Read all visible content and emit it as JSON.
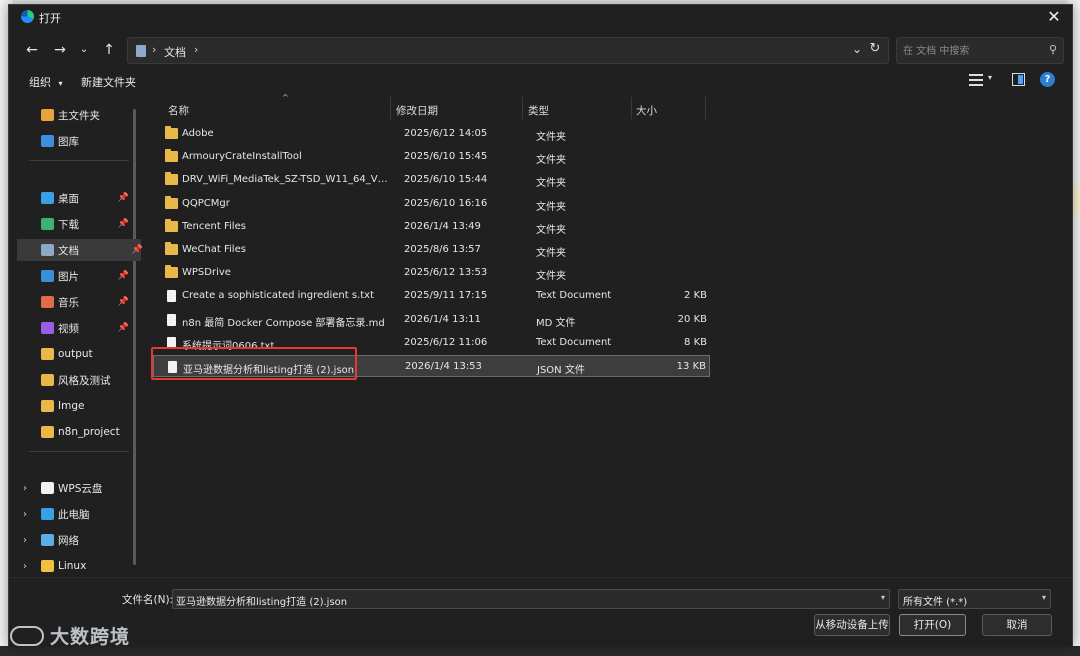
{
  "dialog": {
    "title": "打开"
  },
  "address": {
    "crumb": "文档",
    "separator": "›"
  },
  "search": {
    "placeholder": "在 文档 中搜索"
  },
  "toolbar": {
    "organize": "组织",
    "new_folder": "新建文件夹"
  },
  "nav": {
    "quick": [
      {
        "label": "主文件夹",
        "icon": "home-icon",
        "color": "#e8a33c"
      },
      {
        "label": "图库",
        "icon": "gallery-icon",
        "color": "#3d8ee0"
      }
    ],
    "pinned": [
      {
        "label": "桌面",
        "icon": "desktop-icon",
        "color": "#3aa0e6",
        "pinned": true
      },
      {
        "label": "下载",
        "icon": "download-icon",
        "color": "#3bb27a",
        "pinned": true
      },
      {
        "label": "文档",
        "icon": "documents-icon",
        "color": "#8ea8c8",
        "pinned": true,
        "selected": true
      },
      {
        "label": "图片",
        "icon": "pictures-icon",
        "color": "#3a8fd9",
        "pinned": true
      },
      {
        "label": "音乐",
        "icon": "music-icon",
        "color": "#e26b4a",
        "pinned": true
      },
      {
        "label": "视频",
        "icon": "videos-icon",
        "color": "#9b5de5",
        "pinned": true
      },
      {
        "label": "output",
        "icon": "folder-icon",
        "color": "#e8b84a"
      },
      {
        "label": "风格及测试",
        "icon": "folder-icon",
        "color": "#e8b84a"
      },
      {
        "label": "Imge",
        "icon": "folder-icon",
        "color": "#e8b84a"
      },
      {
        "label": "n8n_project",
        "icon": "folder-icon",
        "color": "#e8b84a"
      }
    ],
    "roots": [
      {
        "label": "WPS云盘",
        "icon": "wps-cloud-icon",
        "color": "#f0f0f0"
      },
      {
        "label": "此电脑",
        "icon": "this-pc-icon",
        "color": "#3aa0e6"
      },
      {
        "label": "网络",
        "icon": "network-icon",
        "color": "#5aaee8"
      },
      {
        "label": "Linux",
        "icon": "linux-icon",
        "color": "#f0c040"
      }
    ]
  },
  "columns": {
    "name": "名称",
    "date": "修改日期",
    "type": "类型",
    "size": "大小"
  },
  "files": [
    {
      "name": "Adobe",
      "date": "2025/6/12 14:05",
      "type": "文件夹",
      "size": "",
      "kind": "folder"
    },
    {
      "name": "ArmouryCrateInstallTool",
      "date": "2025/6/10 15:45",
      "type": "文件夹",
      "size": "",
      "kind": "folder"
    },
    {
      "name": "DRV_WiFi_MediaTek_SZ-TSD_W11_64_V34...",
      "date": "2025/6/10 15:44",
      "type": "文件夹",
      "size": "",
      "kind": "folder"
    },
    {
      "name": "QQPCMgr",
      "date": "2025/6/10 16:16",
      "type": "文件夹",
      "size": "",
      "kind": "folder"
    },
    {
      "name": "Tencent Files",
      "date": "2026/1/4 13:49",
      "type": "文件夹",
      "size": "",
      "kind": "folder"
    },
    {
      "name": "WeChat Files",
      "date": "2025/8/6 13:57",
      "type": "文件夹",
      "size": "",
      "kind": "folder"
    },
    {
      "name": "WPSDrive",
      "date": "2025/6/12 13:53",
      "type": "文件夹",
      "size": "",
      "kind": "folder"
    },
    {
      "name": "Create a sophisticated ingredient s.txt",
      "date": "2025/9/11 17:15",
      "type": "Text Document",
      "size": "2 KB",
      "kind": "file"
    },
    {
      "name": "n8n 最简 Docker Compose 部署备忘录.md",
      "date": "2026/1/4 13:11",
      "type": "MD 文件",
      "size": "20 KB",
      "kind": "file"
    },
    {
      "name": "系统提示词0606.txt",
      "date": "2025/6/12 11:06",
      "type": "Text Document",
      "size": "8 KB",
      "kind": "file"
    },
    {
      "name": "亚马逊数据分析和listing打造 (2).json",
      "date": "2026/1/4 13:53",
      "type": "JSON 文件",
      "size": "13 KB",
      "kind": "file",
      "selected": true
    }
  ],
  "bottom": {
    "filename_label": "文件名(N):",
    "filename_value": "亚马逊数据分析和listing打造 (2).json",
    "filetype_value": "所有文件 (*.*)",
    "upload_button": "从移动设备上传",
    "open_button": "打开(O)",
    "cancel_button": "取消"
  },
  "watermark": {
    "text": "大数跨境"
  }
}
